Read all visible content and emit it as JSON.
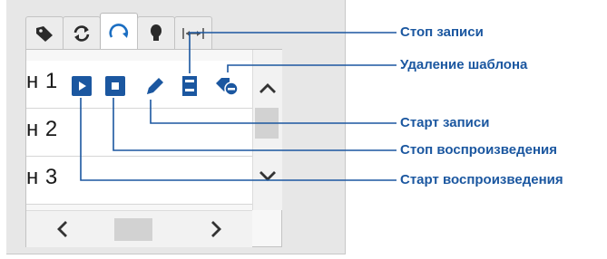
{
  "tabs": [
    {
      "icon": "tag-icon",
      "active": false
    },
    {
      "icon": "repeat-icon",
      "active": false
    },
    {
      "icon": "refresh-arc-icon",
      "active": true
    },
    {
      "icon": "bulb-icon",
      "active": false
    },
    {
      "icon": "expand-width-icon",
      "active": false
    }
  ],
  "rows": [
    {
      "label": "н 1"
    },
    {
      "label": "н 2"
    },
    {
      "label": "н 3"
    }
  ],
  "row_controls": [
    {
      "icon": "play-icon",
      "role": "start-playback"
    },
    {
      "icon": "stop-icon",
      "role": "stop-playback"
    },
    {
      "icon": "pencil-icon",
      "role": "start-recording"
    },
    {
      "icon": "stop-recording-icon",
      "role": "stop-recording"
    },
    {
      "icon": "delete-template-icon",
      "role": "delete-template"
    }
  ],
  "callouts": {
    "stop_recording": "Стоп записи",
    "delete_template": "Удаление шаблона",
    "start_recording": "Старт записи",
    "stop_playback": "Стоп воспроизведения",
    "start_playback": "Старт воспроизведения"
  },
  "colors": {
    "accent": "#1b57a0",
    "panel_bg": "#e7e7e7",
    "scroll_thumb": "#d2d2d2"
  }
}
